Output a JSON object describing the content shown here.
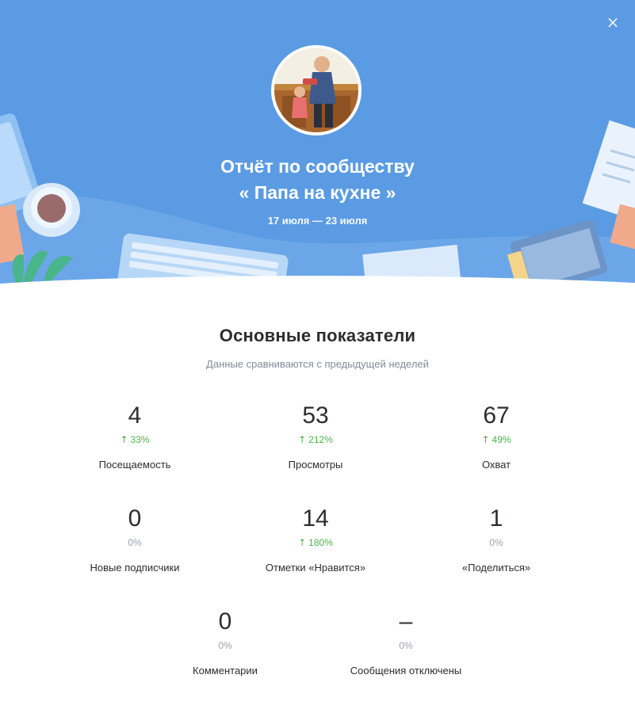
{
  "header": {
    "close_icon": "×",
    "title_line1": "Отчёт по сообществу",
    "title_line2": "« Папа на кухне »",
    "dates": "17 июля — 23 июля"
  },
  "main": {
    "title": "Основные показатели",
    "subtitle": "Данные сравниваются с предыдущей неделей",
    "metrics": [
      {
        "value": "4",
        "change": "33%",
        "trend": "up",
        "label": "Посещаемость"
      },
      {
        "value": "53",
        "change": "212%",
        "trend": "up",
        "label": "Просмотры"
      },
      {
        "value": "67",
        "change": "49%",
        "trend": "up",
        "label": "Охват"
      },
      {
        "value": "0",
        "change": "0%",
        "trend": "none",
        "label": "Новые подписчики"
      },
      {
        "value": "14",
        "change": "180%",
        "trend": "up",
        "label": "Отметки «Нравится»"
      },
      {
        "value": "1",
        "change": "0%",
        "trend": "none",
        "label": "«Поделиться»"
      },
      {
        "value": "0",
        "change": "0%",
        "trend": "none",
        "label": "Комментарии"
      },
      {
        "value": "–",
        "change": "0%",
        "trend": "none",
        "label": "Сообщения отключены"
      }
    ]
  },
  "colors": {
    "header_bg": "#5b9be3",
    "positive": "#4bb34b",
    "neutral": "#99a2ad",
    "text": "#2c2d2e"
  },
  "icons": {
    "close": "close-icon",
    "trend_up": "arrow-up-icon"
  }
}
